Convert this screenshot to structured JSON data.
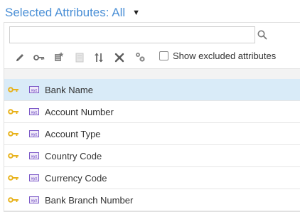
{
  "header": {
    "title": "Selected Attributes: All",
    "caret": "▼"
  },
  "search": {
    "value": "",
    "placeholder": ""
  },
  "toolbar": {
    "show_excluded_label": "Show excluded attributes",
    "show_excluded_checked": false,
    "icons": [
      "edit-pencil-icon",
      "key-icon",
      "add-attribute-icon",
      "document-icon",
      "sort-arrows-icon",
      "delete-x-icon",
      "settings-gears-icon"
    ]
  },
  "attributes": [
    {
      "name": "Bank Name",
      "selected": true,
      "icon": "key-icon",
      "type_badge": "xyz"
    },
    {
      "name": "Account Number",
      "selected": false,
      "icon": "key-icon",
      "type_badge": "xyz"
    },
    {
      "name": "Account Type",
      "selected": false,
      "icon": "key-icon",
      "type_badge": "xyz"
    },
    {
      "name": "Country Code",
      "selected": false,
      "icon": "key-icon",
      "type_badge": "xyz"
    },
    {
      "name": "Currency Code",
      "selected": false,
      "icon": "key-icon",
      "type_badge": "xyz"
    },
    {
      "name": "Bank Branch Number",
      "selected": false,
      "icon": "key-icon",
      "type_badge": "xyz"
    }
  ],
  "colors": {
    "title": "#4a8fd6",
    "selected_row": "#d9ebf8",
    "key_icon": "#e8b21b",
    "badge": "#7d5bc8"
  }
}
